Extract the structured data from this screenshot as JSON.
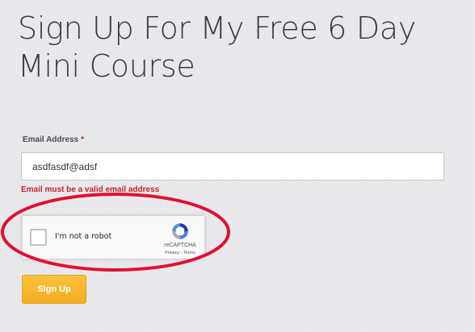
{
  "heading": {
    "line1": "Sign Up For My Free 6 Day",
    "line2": "Mini Course"
  },
  "form": {
    "email_label": "Email Address",
    "required_marker": "*",
    "email_value": "asdfasdf@adsf",
    "error_message": "Email must be a valid email address",
    "submit_label": "Sign Up"
  },
  "recaptcha": {
    "label": "I'm not a robot",
    "checked": false,
    "brand": "reCAPTCHA",
    "privacy_link": "Privacy",
    "separator": "-",
    "terms_link": "Terms"
  },
  "colors": {
    "error": "#c0262c",
    "button": "#f5b22a",
    "annotation": "#e0102e"
  },
  "icons": {
    "recaptcha_logo": "recaptcha-logo-icon"
  }
}
